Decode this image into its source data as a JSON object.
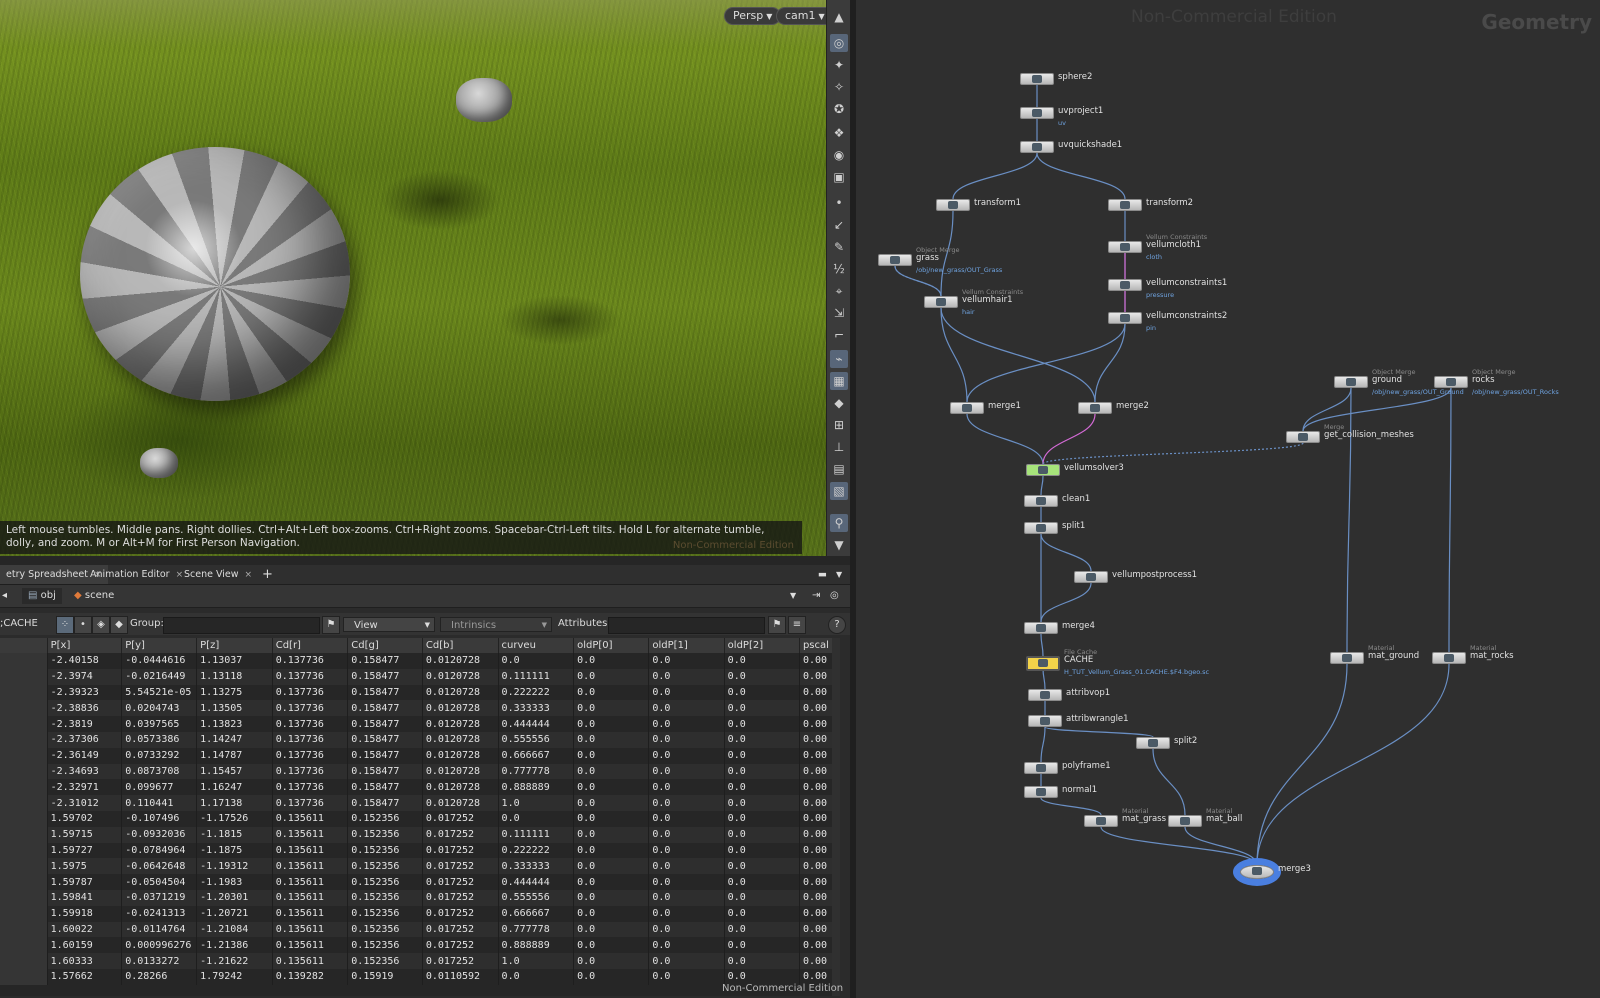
{
  "viewport": {
    "view_dropdown": "Persp",
    "camera_dropdown": "cam1",
    "hint": "Left mouse tumbles. Middle pans. Right dollies. Ctrl+Alt+Left box-zooms. Ctrl+Right zooms. Spacebar-Ctrl-Left tilts. Hold L for alternate tumble, dolly, and zoom.    M or Alt+M for First Person Navigation.",
    "watermark": "Non-Commercial Edition"
  },
  "tabs": [
    {
      "label": "etry Spreadsheet"
    },
    {
      "label": "Animation Editor"
    },
    {
      "label": "Scene View"
    }
  ],
  "path": {
    "obj": "obj",
    "scene": "scene"
  },
  "filter": {
    "node_label": ";CACHE",
    "group_label": "Group:",
    "view_label": "View",
    "intrinsics_label": "Intrinsics",
    "attributes_label": "Attributes:"
  },
  "spreadsheet": {
    "columns": [
      "P[x]",
      "P[y]",
      "P[z]",
      "Cd[r]",
      "Cd[g]",
      "Cd[b]",
      "curveu",
      "oldP[0]",
      "oldP[1]",
      "oldP[2]",
      "pscal"
    ],
    "rows": [
      [
        "-2.40158",
        "-0.0444616",
        "1.13037",
        "0.137736",
        "0.158477",
        "0.0120728",
        "0.0",
        "0.0",
        "0.0",
        "0.0",
        "0.00"
      ],
      [
        "-2.3974",
        "-0.0216449",
        "1.13118",
        "0.137736",
        "0.158477",
        "0.0120728",
        "0.111111",
        "0.0",
        "0.0",
        "0.0",
        "0.00"
      ],
      [
        "-2.39323",
        "5.54521e-05",
        "1.13275",
        "0.137736",
        "0.158477",
        "0.0120728",
        "0.222222",
        "0.0",
        "0.0",
        "0.0",
        "0.00"
      ],
      [
        "-2.38836",
        "0.0204743",
        "1.13505",
        "0.137736",
        "0.158477",
        "0.0120728",
        "0.333333",
        "0.0",
        "0.0",
        "0.0",
        "0.00"
      ],
      [
        "-2.3819",
        "0.0397565",
        "1.13823",
        "0.137736",
        "0.158477",
        "0.0120728",
        "0.444444",
        "0.0",
        "0.0",
        "0.0",
        "0.00"
      ],
      [
        "-2.37306",
        "0.0573386",
        "1.14247",
        "0.137736",
        "0.158477",
        "0.0120728",
        "0.555556",
        "0.0",
        "0.0",
        "0.0",
        "0.00"
      ],
      [
        "-2.36149",
        "0.0733292",
        "1.14787",
        "0.137736",
        "0.158477",
        "0.0120728",
        "0.666667",
        "0.0",
        "0.0",
        "0.0",
        "0.00"
      ],
      [
        "-2.34693",
        "0.0873708",
        "1.15457",
        "0.137736",
        "0.158477",
        "0.0120728",
        "0.777778",
        "0.0",
        "0.0",
        "0.0",
        "0.00"
      ],
      [
        "-2.32971",
        "0.099677",
        "1.16247",
        "0.137736",
        "0.158477",
        "0.0120728",
        "0.888889",
        "0.0",
        "0.0",
        "0.0",
        "0.00"
      ],
      [
        "-2.31012",
        "0.110441",
        "1.17138",
        "0.137736",
        "0.158477",
        "0.0120728",
        "1.0",
        "0.0",
        "0.0",
        "0.0",
        "0.00"
      ],
      [
        "1.59702",
        "-0.107496",
        "-1.17526",
        "0.135611",
        "0.152356",
        "0.017252",
        "0.0",
        "0.0",
        "0.0",
        "0.0",
        "0.00"
      ],
      [
        "1.59715",
        "-0.0932036",
        "-1.1815",
        "0.135611",
        "0.152356",
        "0.017252",
        "0.111111",
        "0.0",
        "0.0",
        "0.0",
        "0.00"
      ],
      [
        "1.59727",
        "-0.0784964",
        "-1.1875",
        "0.135611",
        "0.152356",
        "0.017252",
        "0.222222",
        "0.0",
        "0.0",
        "0.0",
        "0.00"
      ],
      [
        "1.5975",
        "-0.0642648",
        "-1.19312",
        "0.135611",
        "0.152356",
        "0.017252",
        "0.333333",
        "0.0",
        "0.0",
        "0.0",
        "0.00"
      ],
      [
        "1.59787",
        "-0.0504504",
        "-1.1983",
        "0.135611",
        "0.152356",
        "0.017252",
        "0.444444",
        "0.0",
        "0.0",
        "0.0",
        "0.00"
      ],
      [
        "1.59841",
        "-0.0371219",
        "-1.20301",
        "0.135611",
        "0.152356",
        "0.017252",
        "0.555556",
        "0.0",
        "0.0",
        "0.0",
        "0.00"
      ],
      [
        "1.59918",
        "-0.0241313",
        "-1.20721",
        "0.135611",
        "0.152356",
        "0.017252",
        "0.666667",
        "0.0",
        "0.0",
        "0.0",
        "0.00"
      ],
      [
        "1.60022",
        "-0.0114764",
        "-1.21084",
        "0.135611",
        "0.152356",
        "0.017252",
        "0.777778",
        "0.0",
        "0.0",
        "0.0",
        "0.00"
      ],
      [
        "1.60159",
        "0.000996276",
        "-1.21386",
        "0.135611",
        "0.152356",
        "0.017252",
        "0.888889",
        "0.0",
        "0.0",
        "0.0",
        "0.00"
      ],
      [
        "1.60333",
        "0.0133272",
        "-1.21622",
        "0.135611",
        "0.152356",
        "0.017252",
        "1.0",
        "0.0",
        "0.0",
        "0.0",
        "0.00"
      ],
      [
        "1.57662",
        "0.28266",
        "1.79242",
        "0.139282",
        "0.15919",
        "0.0110592",
        "0.0",
        "0.0",
        "0.0",
        "0.0",
        "0.00"
      ]
    ],
    "footer_watermark": "Non-Commercial Edition"
  },
  "network": {
    "watermark": "Non-Commercial Edition",
    "context": "Geometry",
    "colors": {
      "wire": "#6a8fc4",
      "wire_pink": "#d46ad6",
      "solver": "#a6e37a",
      "cache": "#f2d34a",
      "selected_ring": "#4a7fe0"
    },
    "nodes": [
      {
        "id": "sphere2",
        "label": "sphere2",
        "type": "",
        "sub": ""
      },
      {
        "id": "uvproject1",
        "label": "uvproject1",
        "type": "",
        "sub": "uv"
      },
      {
        "id": "uvquickshade1",
        "label": "uvquickshade1",
        "type": "",
        "sub": ""
      },
      {
        "id": "transform1",
        "label": "transform1",
        "type": "",
        "sub": ""
      },
      {
        "id": "transform2",
        "label": "transform2",
        "type": "",
        "sub": ""
      },
      {
        "id": "grass",
        "label": "grass",
        "type": "Object Merge",
        "sub": "/obj/new_grass/OUT_Grass"
      },
      {
        "id": "vellumhair1",
        "label": "vellumhair1",
        "type": "Vellum Constraints",
        "sub": "hair"
      },
      {
        "id": "vellumcloth1",
        "label": "vellumcloth1",
        "type": "Vellum Constraints",
        "sub": "cloth"
      },
      {
        "id": "vellumconstraints1",
        "label": "vellumconstraints1",
        "type": "",
        "sub": "pressure"
      },
      {
        "id": "vellumconstraints2",
        "label": "vellumconstraints2",
        "type": "",
        "sub": "pin"
      },
      {
        "id": "merge1",
        "label": "merge1",
        "type": "",
        "sub": ""
      },
      {
        "id": "merge2",
        "label": "merge2",
        "type": "",
        "sub": ""
      },
      {
        "id": "ground",
        "label": "ground",
        "type": "Object Merge",
        "sub": "/obj/new_grass/OUT_Ground"
      },
      {
        "id": "rocks",
        "label": "rocks",
        "type": "Object Merge",
        "sub": "/obj/new_grass/OUT_Rocks"
      },
      {
        "id": "get_collision_meshes",
        "label": "get_collision_meshes",
        "type": "Merge",
        "sub": ""
      },
      {
        "id": "vellumsolver3",
        "label": "vellumsolver3",
        "type": "",
        "sub": ""
      },
      {
        "id": "clean1",
        "label": "clean1",
        "type": "",
        "sub": ""
      },
      {
        "id": "split1",
        "label": "split1",
        "type": "",
        "sub": ""
      },
      {
        "id": "vellumpostprocess1",
        "label": "vellumpostprocess1",
        "type": "",
        "sub": ""
      },
      {
        "id": "merge4",
        "label": "merge4",
        "type": "",
        "sub": ""
      },
      {
        "id": "CACHE",
        "label": "CACHE",
        "type": "File Cache",
        "sub": "H_TUT_Vellum_Grass_01.CACHE.$F4.bgeo.sc"
      },
      {
        "id": "attribvop1",
        "label": "attribvop1",
        "type": "",
        "sub": ""
      },
      {
        "id": "attribwrangle1",
        "label": "attribwrangle1",
        "type": "",
        "sub": ""
      },
      {
        "id": "split2",
        "label": "split2",
        "type": "",
        "sub": ""
      },
      {
        "id": "polyframe1",
        "label": "polyframe1",
        "type": "",
        "sub": ""
      },
      {
        "id": "normal1",
        "label": "normal1",
        "type": "",
        "sub": ""
      },
      {
        "id": "mat_grass",
        "label": "mat_grass",
        "type": "Material",
        "sub": ""
      },
      {
        "id": "mat_ball",
        "label": "mat_ball",
        "type": "Material",
        "sub": ""
      },
      {
        "id": "mat_ground",
        "label": "mat_ground",
        "type": "Material",
        "sub": ""
      },
      {
        "id": "mat_rocks",
        "label": "mat_rocks",
        "type": "Material",
        "sub": ""
      },
      {
        "id": "merge3",
        "label": "merge3",
        "type": "",
        "sub": ""
      }
    ]
  }
}
